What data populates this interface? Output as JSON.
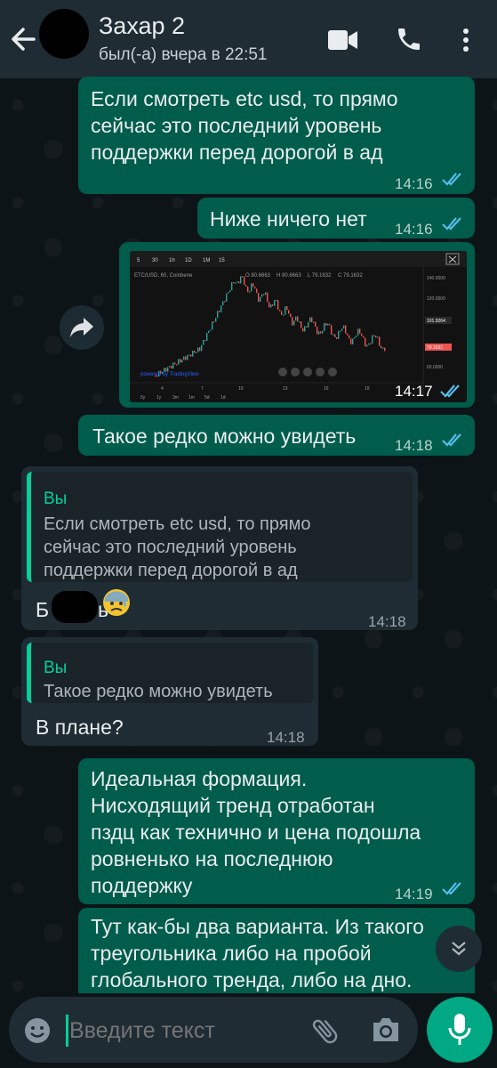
{
  "header": {
    "contact_name": "Захар 2",
    "status": "был(-а) вчера в 22:51"
  },
  "messages": [
    {
      "dir": "out",
      "text_lines": [
        "Если смотреть etc usd, то прямо",
        "сейчас это последний уровень",
        "поддержки перед дорогой в ад"
      ],
      "time": "14:16",
      "read": true
    },
    {
      "dir": "out",
      "text": "Ниже ничего нет",
      "time": "14:16",
      "read": true
    },
    {
      "dir": "out",
      "type": "image",
      "time": "14:17",
      "read": true
    },
    {
      "dir": "out",
      "text": "Такое редко можно увидеть",
      "time": "14:18",
      "read": true
    },
    {
      "dir": "in",
      "quote_author": "Вы",
      "quote_lines": [
        "Если смотреть etc usd, то прямо",
        "сейчас это последний уровень",
        "поддержки перед дорогой в ад"
      ],
      "text_start": "Б",
      "text_end": "ь",
      "emoji": "😰",
      "time": "14:18"
    },
    {
      "dir": "in",
      "quote_author": "Вы",
      "quote_text": "Такое редко можно увидеть",
      "text": "В плане?",
      "time": "14:18"
    },
    {
      "dir": "out",
      "text_lines": [
        "Идеальная формация.",
        "Нисходящий тренд отработан",
        "пздц как технично и цена подошла",
        "ровненько на последнюю",
        "поддержку"
      ],
      "time": "14:19",
      "read": true
    },
    {
      "dir": "out",
      "text_lines": [
        "Тут как-бы два варианта. Из такого",
        "треугольника либо на пробой",
        "глобального тренда, либо на дно."
      ]
    }
  ],
  "chart_image": {
    "toolbar": [
      "5",
      "30",
      "1h",
      "1D",
      "1M",
      "15"
    ],
    "symbol_line": "ETC/USD, 60, Coinbene",
    "ohlc": [
      "O 80.6663",
      "H 80.6663",
      "L 79.1632",
      "C 79.1632"
    ],
    "price_labels": [
      "140.0000",
      "120.0000",
      "101.9264",
      "79.1632",
      "60.0000"
    ],
    "x_labels": [
      "4",
      "7",
      "10",
      "13",
      "16",
      "19"
    ],
    "ranges": [
      "5y",
      "1y",
      "3m",
      "1m",
      "5d",
      "1d"
    ],
    "watermark": "powered by TradingView",
    "colors": {
      "up": "#26a69a",
      "down": "#ef5350"
    }
  },
  "input": {
    "placeholder": "Введите текст"
  },
  "icons": [
    "back-arrow-icon",
    "video-call-icon",
    "phone-icon",
    "more-options-icon",
    "forward-icon",
    "emoji-icon",
    "attach-icon",
    "camera-icon",
    "mic-icon",
    "chevron-down-icon",
    "double-check-icon"
  ],
  "colors": {
    "outgoing_bubble": "#005c4b",
    "incoming_bubble": "#1f2c34",
    "accent": "#06cf9c",
    "read_ticks": "#53bdeb",
    "mic_button": "#00a884"
  }
}
